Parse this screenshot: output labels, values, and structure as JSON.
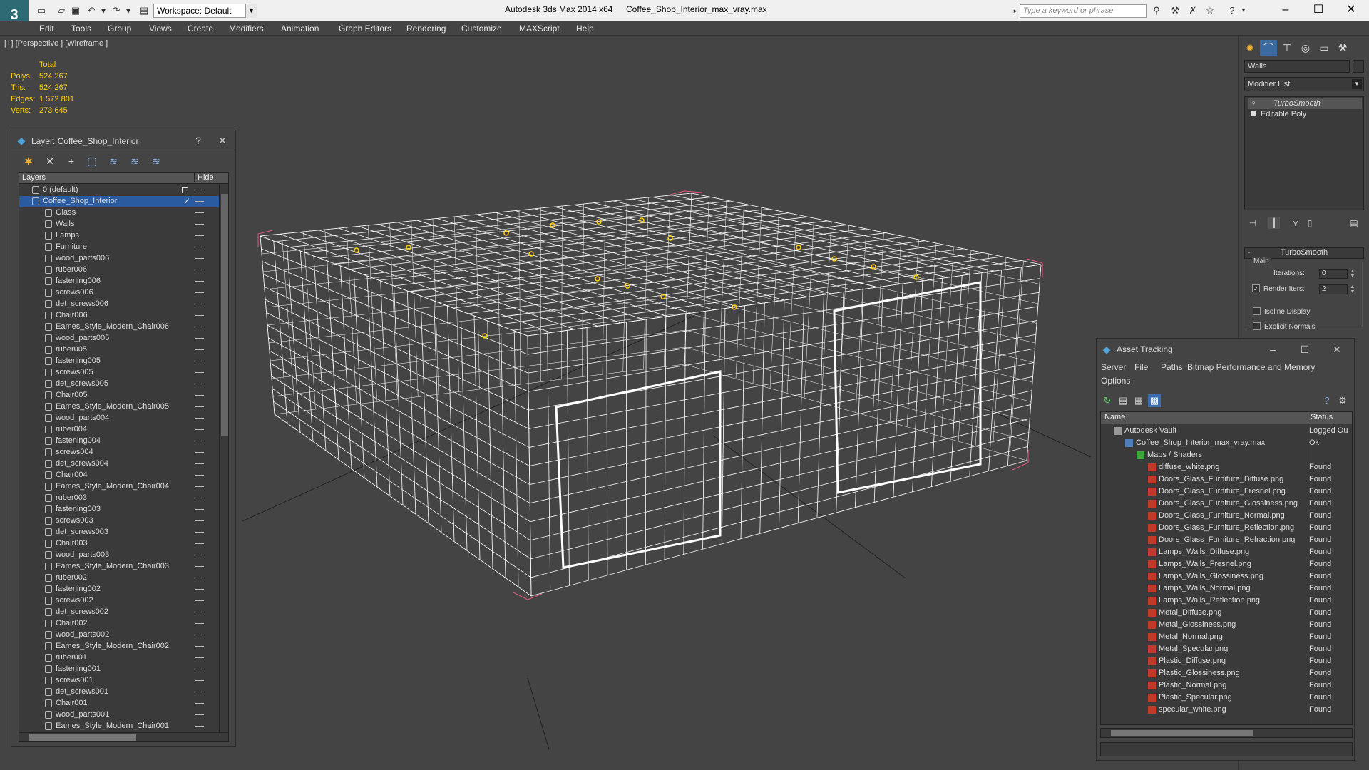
{
  "window": {
    "app_title": "Autodesk 3ds Max  2014 x64",
    "file_title": "Coffee_Shop_Interior_max_vray.max",
    "logo": "3",
    "workspace": "Workspace: Default",
    "search_placeholder": "Type a keyword or phrase",
    "minimize": "–",
    "maximize": "☐",
    "close": "✕"
  },
  "menu": [
    "Edit",
    "Tools",
    "Group",
    "Views",
    "Create",
    "Modifiers",
    "Animation",
    "Graph Editors",
    "Rendering",
    "Customize",
    "MAXScript",
    "Help"
  ],
  "viewport": {
    "label": "[+] [Perspective ] [Wireframe ]",
    "stats_header": "Total",
    "stats": [
      {
        "label": "Polys:",
        "value": "524 267"
      },
      {
        "label": "Tris:",
        "value": "524 267"
      },
      {
        "label": "Edges:",
        "value": "1 572 801"
      },
      {
        "label": "Verts:",
        "value": "273 645"
      }
    ],
    "colors": {
      "wire": "#ffffff",
      "bbox": "#e05a7a",
      "light": "#ffd200",
      "grid": "#222222"
    }
  },
  "layer_panel": {
    "title": "Layer: Coffee_Shop_Interior",
    "help": "?",
    "close": "✕",
    "col_layers": "Layers",
    "col_hide": "Hide",
    "rows": [
      {
        "name": "0 (default)",
        "level": 0
      },
      {
        "name": "Coffee_Shop_Interior",
        "level": 0,
        "selected": true
      },
      {
        "name": "Glass",
        "level": 1
      },
      {
        "name": "Walls",
        "level": 1
      },
      {
        "name": "Lamps",
        "level": 1
      },
      {
        "name": "Furniture",
        "level": 1
      },
      {
        "name": "wood_parts006",
        "level": 1
      },
      {
        "name": "ruber006",
        "level": 1
      },
      {
        "name": "fastening006",
        "level": 1
      },
      {
        "name": "screws006",
        "level": 1
      },
      {
        "name": "det_screws006",
        "level": 1
      },
      {
        "name": "Chair006",
        "level": 1
      },
      {
        "name": "Eames_Style_Modern_Chair006",
        "level": 1
      },
      {
        "name": "wood_parts005",
        "level": 1
      },
      {
        "name": "ruber005",
        "level": 1
      },
      {
        "name": "fastening005",
        "level": 1
      },
      {
        "name": "screws005",
        "level": 1
      },
      {
        "name": "det_screws005",
        "level": 1
      },
      {
        "name": "Chair005",
        "level": 1
      },
      {
        "name": "Eames_Style_Modern_Chair005",
        "level": 1
      },
      {
        "name": "wood_parts004",
        "level": 1
      },
      {
        "name": "ruber004",
        "level": 1
      },
      {
        "name": "fastening004",
        "level": 1
      },
      {
        "name": "screws004",
        "level": 1
      },
      {
        "name": "det_screws004",
        "level": 1
      },
      {
        "name": "Chair004",
        "level": 1
      },
      {
        "name": "Eames_Style_Modern_Chair004",
        "level": 1
      },
      {
        "name": "ruber003",
        "level": 1
      },
      {
        "name": "fastening003",
        "level": 1
      },
      {
        "name": "screws003",
        "level": 1
      },
      {
        "name": "det_screws003",
        "level": 1
      },
      {
        "name": "Chair003",
        "level": 1
      },
      {
        "name": "wood_parts003",
        "level": 1
      },
      {
        "name": "Eames_Style_Modern_Chair003",
        "level": 1
      },
      {
        "name": "ruber002",
        "level": 1
      },
      {
        "name": "fastening002",
        "level": 1
      },
      {
        "name": "screws002",
        "level": 1
      },
      {
        "name": "det_screws002",
        "level": 1
      },
      {
        "name": "Chair002",
        "level": 1
      },
      {
        "name": "wood_parts002",
        "level": 1
      },
      {
        "name": "Eames_Style_Modern_Chair002",
        "level": 1
      },
      {
        "name": "ruber001",
        "level": 1
      },
      {
        "name": "fastening001",
        "level": 1
      },
      {
        "name": "screws001",
        "level": 1
      },
      {
        "name": "det_screws001",
        "level": 1
      },
      {
        "name": "Chair001",
        "level": 1
      },
      {
        "name": "wood_parts001",
        "level": 1
      },
      {
        "name": "Eames_Style_Modern_Chair001",
        "level": 1
      }
    ]
  },
  "command_panel": {
    "object_name": "Walls",
    "modifier_list": "Modifier List",
    "stack": [
      "TurboSmooth",
      "Editable Poly"
    ],
    "rollout_title": "TurboSmooth",
    "group_main": "Main",
    "iterations_label": "Iterations:",
    "iterations_value": "0",
    "render_iters_label": "Render Iters:",
    "render_iters_value": "2",
    "render_iters_checked": "✓",
    "isoline_label": "Isoline Display",
    "explicit_label": "Explicit Normals",
    "rollout_collapse": "-"
  },
  "asset_panel": {
    "title": "Asset Tracking",
    "menus": [
      "Server",
      "File",
      "Paths",
      "Bitmap Performance and Memory",
      "Options"
    ],
    "col_name": "Name",
    "col_status": "Status",
    "rows": [
      {
        "name": "Autodesk Vault",
        "status": "Logged Ou",
        "level": 0,
        "icon": "vault"
      },
      {
        "name": "Coffee_Shop_Interior_max_vray.max",
        "status": "Ok",
        "level": 1,
        "icon": "max"
      },
      {
        "name": "Maps / Shaders",
        "status": "",
        "level": 2,
        "icon": "maps"
      },
      {
        "name": "diffuse_white.png",
        "status": "Found",
        "level": 3,
        "icon": "png"
      },
      {
        "name": "Doors_Glass_Furniture_Diffuse.png",
        "status": "Found",
        "level": 3,
        "icon": "png"
      },
      {
        "name": "Doors_Glass_Furniture_Fresnel.png",
        "status": "Found",
        "level": 3,
        "icon": "png"
      },
      {
        "name": "Doors_Glass_Furniture_Glossiness.png",
        "status": "Found",
        "level": 3,
        "icon": "png"
      },
      {
        "name": "Doors_Glass_Furniture_Normal.png",
        "status": "Found",
        "level": 3,
        "icon": "png"
      },
      {
        "name": "Doors_Glass_Furniture_Reflection.png",
        "status": "Found",
        "level": 3,
        "icon": "png"
      },
      {
        "name": "Doors_Glass_Furniture_Refraction.png",
        "status": "Found",
        "level": 3,
        "icon": "png"
      },
      {
        "name": "Lamps_Walls_Diffuse.png",
        "status": "Found",
        "level": 3,
        "icon": "png"
      },
      {
        "name": "Lamps_Walls_Fresnel.png",
        "status": "Found",
        "level": 3,
        "icon": "png"
      },
      {
        "name": "Lamps_Walls_Glossiness.png",
        "status": "Found",
        "level": 3,
        "icon": "png"
      },
      {
        "name": "Lamps_Walls_Normal.png",
        "status": "Found",
        "level": 3,
        "icon": "png"
      },
      {
        "name": "Lamps_Walls_Reflection.png",
        "status": "Found",
        "level": 3,
        "icon": "png"
      },
      {
        "name": "Metal_Diffuse.png",
        "status": "Found",
        "level": 3,
        "icon": "png"
      },
      {
        "name": "Metal_Glossiness.png",
        "status": "Found",
        "level": 3,
        "icon": "png"
      },
      {
        "name": "Metal_Normal.png",
        "status": "Found",
        "level": 3,
        "icon": "png"
      },
      {
        "name": "Metal_Specular.png",
        "status": "Found",
        "level": 3,
        "icon": "png"
      },
      {
        "name": "Plastic_Diffuse.png",
        "status": "Found",
        "level": 3,
        "icon": "png"
      },
      {
        "name": "Plastic_Glossiness.png",
        "status": "Found",
        "level": 3,
        "icon": "png"
      },
      {
        "name": "Plastic_Normal.png",
        "status": "Found",
        "level": 3,
        "icon": "png"
      },
      {
        "name": "Plastic_Specular.png",
        "status": "Found",
        "level": 3,
        "icon": "png"
      },
      {
        "name": "specular_white.png",
        "status": "Found",
        "level": 3,
        "icon": "png"
      }
    ]
  }
}
